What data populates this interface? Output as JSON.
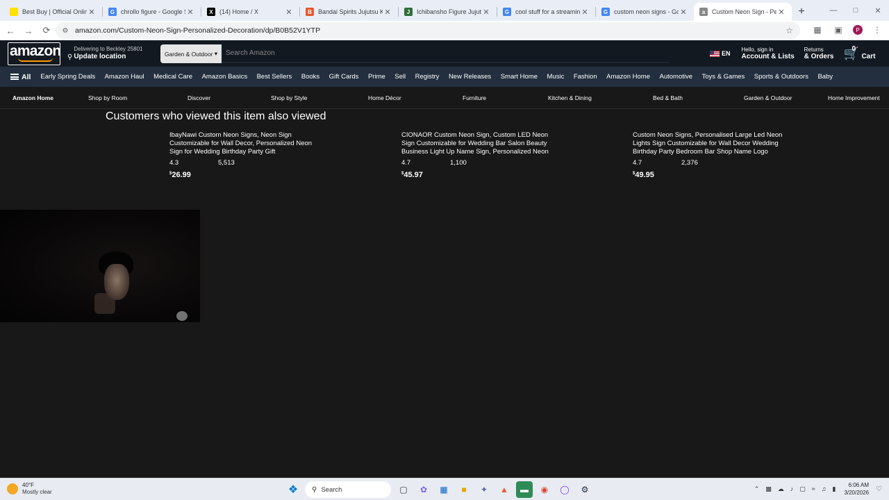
{
  "browser": {
    "tabs": [
      {
        "title": "Best Buy | Official Online St",
        "favicon_color": "#ffe000",
        "favicon_text": ""
      },
      {
        "title": "chrollo figure - Google Sea",
        "favicon_color": "#4285f4",
        "favicon_text": "G"
      },
      {
        "title": "(14) Home / X",
        "favicon_color": "#000000",
        "favicon_text": "X"
      },
      {
        "title": "Bandai Spirits Jujutsu Kais",
        "favicon_color": "#e8572f",
        "favicon_text": "B"
      },
      {
        "title": "Ichibansho Figure Jujutsu",
        "favicon_color": "#2f6e3a",
        "favicon_text": "J"
      },
      {
        "title": "cool stuff for a streaming",
        "favicon_color": "#4285f4",
        "favicon_text": "G"
      },
      {
        "title": "custom neon signs - Goog",
        "favicon_color": "#4285f4",
        "favicon_text": "G"
      },
      {
        "title": "Custom Neon Sign - Perso",
        "favicon_color": "#888888",
        "favicon_text": "a"
      }
    ],
    "active_tab_index": 7,
    "new_tab_label": "+",
    "url": "amazon.com/Custom-Neon-Sign-Personalized-Decoration/dp/B0B52V1YTP",
    "profile_initial": "P"
  },
  "amazon": {
    "logo": "amazon",
    "deliver_line1": "Delivering to Beckley 25801",
    "deliver_line2": "Update location",
    "search_category": "Garden & Outdoor",
    "search_placeholder": "Search Amazon",
    "language": "EN",
    "account_line1": "Hello, sign in",
    "account_line2": "Account & Lists",
    "returns_line1": "Returns",
    "returns_line2": "& Orders",
    "cart_count": "0",
    "cart_label": "Cart",
    "nav_all": "All",
    "nav_items": [
      "Early Spring Deals",
      "Amazon Haul",
      "Medical Care",
      "Amazon Basics",
      "Best Sellers",
      "Books",
      "Gift Cards",
      "Prime",
      "Sell",
      "Registry",
      "New Releases",
      "Smart Home",
      "Music",
      "Fashion",
      "Amazon Home",
      "Automotive",
      "Toys & Games",
      "Sports & Outdoors",
      "Baby"
    ],
    "subnav_items": [
      "Amazon Home",
      "Shop by Room",
      "Discover",
      "Shop by Style",
      "Home Décor",
      "Furniture",
      "Kitchen & Dining",
      "Bed & Bath",
      "Garden & Outdoor",
      "Home Improvement"
    ]
  },
  "content": {
    "section_title": "Customers who viewed this item also viewed",
    "products": [
      {
        "title": "IbayNawi Custom Neon Signs, Neon Sign Customizable for Wall Decor, Personalized Neon Sign for Wedding Birthday Party Gift",
        "rating": "4.3",
        "review_count": "5,513",
        "currency": "$",
        "price": "26.99"
      },
      {
        "title": "CIONAOR Custom Neon Sign, Custom LED Neon Sign Customizable for Wedding Bar Salon Beauty Business Light Up Name Sign, Personalized Neon",
        "rating": "4.7",
        "review_count": "1,100",
        "currency": "$",
        "price": "45.97"
      },
      {
        "title": "Custom Neon Signs, Personalised Large Led Neon Lights Sign Customizable for Wall Decor Wedding Birthday Party Bedroom Bar Shop Name Logo",
        "rating": "4.7",
        "review_count": "2,376",
        "currency": "$",
        "price": "49.95"
      }
    ]
  },
  "taskbar": {
    "weather_temp": "40°F",
    "weather_desc": "Mostly clear",
    "search_label": "Search",
    "time": "6:06 AM",
    "date": "3/20/2026"
  }
}
